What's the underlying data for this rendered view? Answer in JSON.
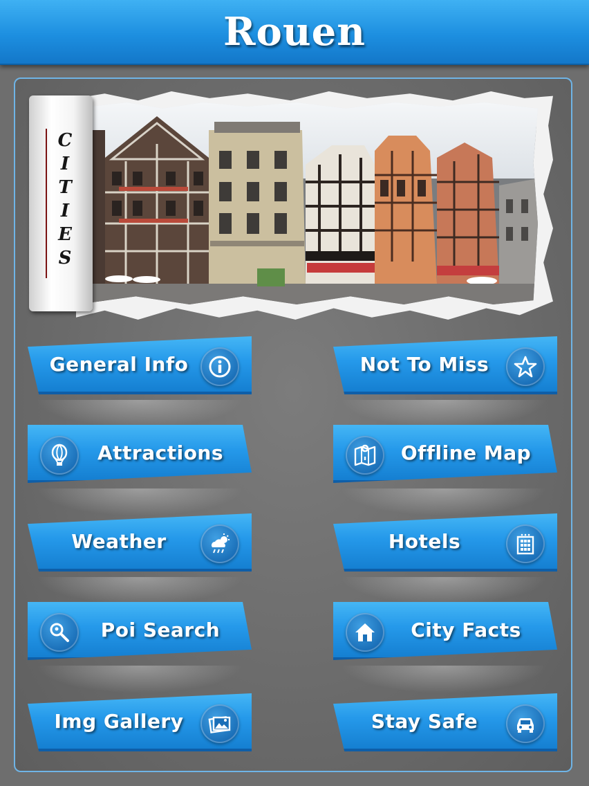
{
  "header": {
    "title": "Rouen"
  },
  "banner": {
    "side_label": "CITIES"
  },
  "menu": {
    "general_info": "General Info",
    "not_to_miss": "Not To Miss",
    "attractions": "Attractions",
    "offline_map": "Offline Map",
    "weather": "Weather",
    "hotels": "Hotels",
    "poi_search": "Poi Search",
    "city_facts": "City Facts",
    "img_gallery": "Img Gallery",
    "stay_safe": "Stay Safe"
  },
  "icons": {
    "general_info": "info-icon",
    "not_to_miss": "star-icon",
    "attractions": "hot-air-balloon-icon",
    "offline_map": "map-pin-icon",
    "weather": "weather-icon",
    "hotels": "hotel-building-icon",
    "poi_search": "poi-search-icon",
    "city_facts": "home-icon",
    "img_gallery": "image-gallery-icon",
    "stay_safe": "car-icon"
  },
  "colors": {
    "header_blue": "#1d8fe0",
    "button_blue": "#2599ea",
    "background_gray": "#6e6e6e",
    "panel_border": "#6fb4e6"
  }
}
